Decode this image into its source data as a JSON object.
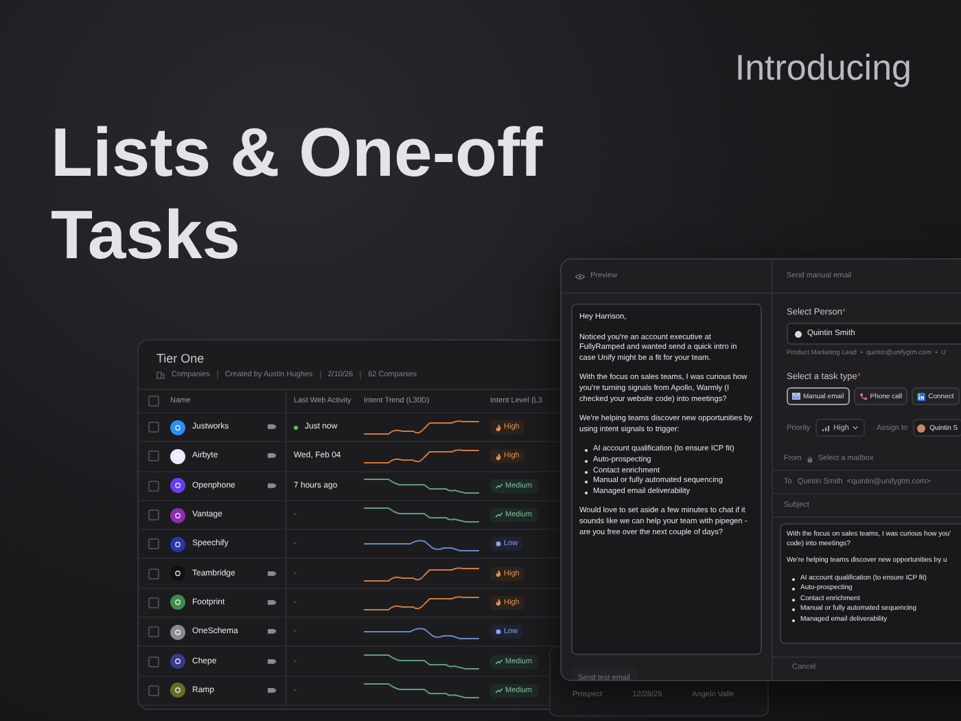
{
  "eyebrow": "Introducing",
  "headline": [
    "Lists & One-off",
    "Tasks"
  ],
  "list_panel": {
    "title": "Tier One",
    "meta": [
      "Companies",
      "Created by Austin Hughes",
      "2/10/26",
      "62 Companies"
    ],
    "all_checked": false,
    "columns": [
      "Name",
      "Last Web Activity",
      "Intent Trend (L30D)",
      "Intent Level (L3"
    ],
    "rows": [
      {
        "name": "Justworks",
        "color": "#2a8ff7",
        "note": true,
        "checked": false,
        "activity": "Just now",
        "live": true,
        "intent": {
          "label": "High",
          "kind": "high"
        }
      },
      {
        "name": "Airbyte",
        "color": "#ece8ff",
        "note": true,
        "checked": false,
        "activity": "Wed, Feb 04",
        "live": false,
        "intent": {
          "label": "High",
          "kind": "high"
        }
      },
      {
        "name": "Openphone",
        "color": "#6a3df0",
        "note": true,
        "checked": false,
        "activity": "7 hours ago",
        "live": false,
        "intent": {
          "label": "Medium",
          "kind": "medium"
        }
      },
      {
        "name": "Vantage",
        "color": "#8a2fb0",
        "note": false,
        "checked": false,
        "activity": "-",
        "live": false,
        "intent": {
          "label": "Medium",
          "kind": "medium"
        }
      },
      {
        "name": "Speechify",
        "color": "#2b35a8",
        "note": false,
        "checked": false,
        "activity": "-",
        "live": false,
        "intent": {
          "label": "Low",
          "kind": "low"
        }
      },
      {
        "name": "Teambridge",
        "color": "#101012",
        "note": true,
        "checked": false,
        "activity": "-",
        "live": false,
        "intent": {
          "label": "High",
          "kind": "high"
        }
      },
      {
        "name": "Footprint",
        "color": "#3d8c4c",
        "note": true,
        "checked": false,
        "activity": "-",
        "live": false,
        "intent": {
          "label": "High",
          "kind": "high"
        }
      },
      {
        "name": "OneSchema",
        "color": "#8a8a90",
        "note": true,
        "checked": false,
        "activity": "-",
        "live": false,
        "intent": {
          "label": "Low",
          "kind": "low"
        }
      },
      {
        "name": "Chepe",
        "color": "#3a3a8a",
        "note": true,
        "checked": false,
        "activity": "-",
        "live": false,
        "intent": {
          "label": "Medium",
          "kind": "medium"
        }
      },
      {
        "name": "Ramp",
        "color": "#6a6a2a",
        "note": true,
        "checked": false,
        "activity": "-",
        "live": false,
        "intent": {
          "label": "Medium",
          "kind": "medium"
        }
      }
    ]
  },
  "background_row": [
    "Prospect",
    "12/28/25",
    "Angelo Valle"
  ],
  "preview": {
    "title": "Preview",
    "greeting": "Hey Harrison,",
    "paragraphs": [
      "Noticed you're an account executive at FullyRamped and wanted send a quick intro in case Unify might be a fit for your team.",
      "With the focus on sales teams, I was curious how you're turning signals from Apollo, Warmly (I checked your website code) into meetings?",
      "We're helping teams discover new opportunities by using intent signals to trigger:"
    ],
    "bullets": [
      "AI account qualification (to ensure ICP fit)",
      "Auto-prospecting",
      "Contact enrichment",
      "Manual or fully automated sequencing",
      "Managed email deliverability"
    ],
    "closing": "Would love to set aside a few minutes to chat if it sounds like we can help your team with pipegen - are you free over the next couple of days?",
    "button": "Send test email"
  },
  "task": {
    "title": "Send manual email",
    "person_label": {
      "text": "Select Person",
      "mark": "*"
    },
    "person": "Quintin Smith",
    "person_details": "Product Marketing Lead  •  quintin@unifygtm.com  •  U",
    "type_label": {
      "text": "Select a task type",
      "mark": "*"
    },
    "types": [
      {
        "label": "Manual email",
        "kind": "email",
        "selected": true
      },
      {
        "label": "Phone call",
        "kind": "phone",
        "selected": false
      },
      {
        "label": "Connect",
        "kind": "linkedin",
        "selected": false
      }
    ],
    "priority_label": "Priority",
    "priority": "High",
    "assign_label": "Assign to",
    "assignee": "Quintin S",
    "from_label": "From",
    "from_placeholder": "Select a mailbox",
    "to_label": "To",
    "to_value": "Quintin Smith  <quintin@unifygtm.com>",
    "subject_placeholder": "Subject",
    "body_paragraphs": [
      [
        "With the focus on sales teams, I was curious how you'",
        "code) into meetings?"
      ],
      [
        "We're helping teams discover new opportunities by u"
      ]
    ],
    "body_bullets": [
      "AI account qualification (to ensure ICP fit)",
      "Auto-prospecting",
      "Contact enrichment",
      "Manual or fully automated sequencing",
      "Managed email deliverability"
    ],
    "cancel": "Cancel"
  }
}
